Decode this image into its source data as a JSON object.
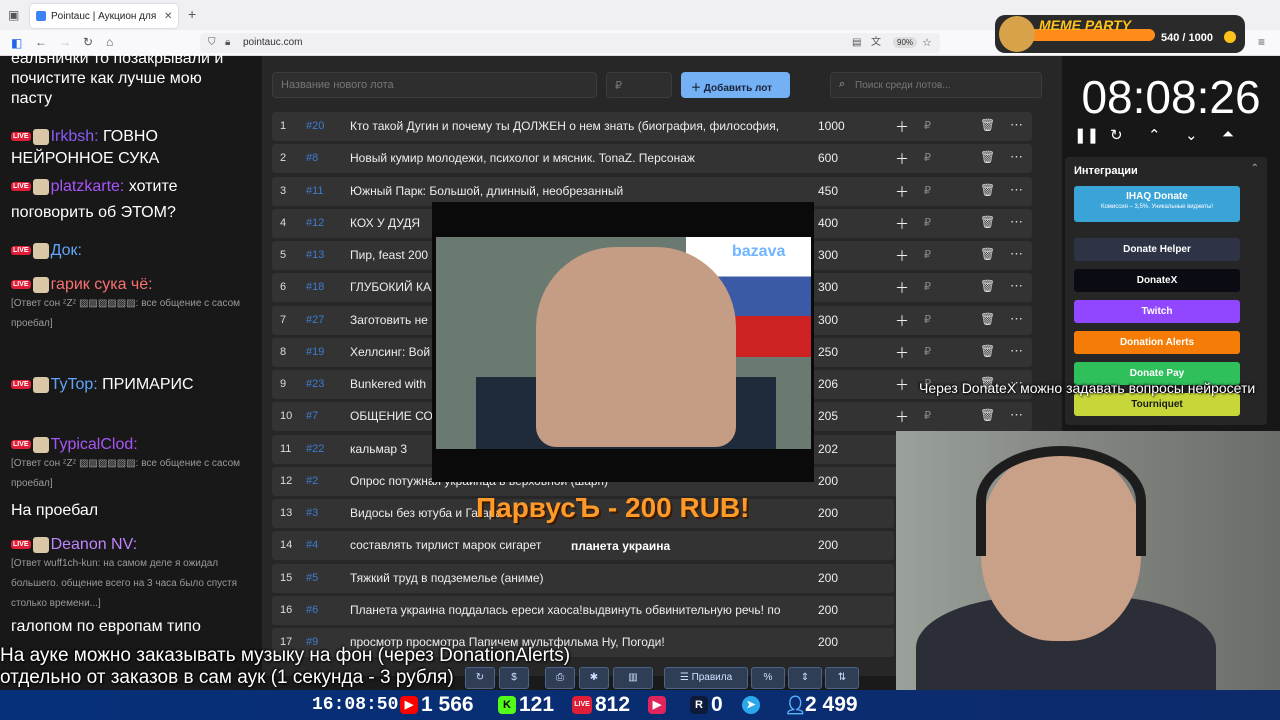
{
  "browser": {
    "tab_title": "Pointauc | Аукцион для стримеров",
    "url": "pointauc.com",
    "zoom": "90%"
  },
  "meme_party": {
    "logo": "MEME PARTY",
    "points": "540 / 1000"
  },
  "chat": {
    "lines": [
      {
        "text": "еальнички то позакрывали и"
      },
      {
        "text": "почистите как лучше мою"
      },
      {
        "text": "пасту"
      },
      {
        "user": "Irkbsh:",
        "text": " ГОВНО",
        "color": "#8b5cf6"
      },
      {
        "text": "НЕЙРОННОЕ СУКА"
      },
      {
        "user": "platzkarte:",
        "text": " хотите",
        "color": "#a855f7"
      },
      {
        "text": "поговорить об ЭТОМ?"
      },
      {
        "user": "Док:",
        "text": "",
        "color": "#60a5fa"
      },
      {
        "user": "гарик сука чё:",
        "text": "",
        "color": "#f87171"
      },
      {
        "text": "[Ответ сон ᶻZᶻ ▨▨▨▨▨▨: все общение с сасом"
      },
      {
        "text": "проебал]"
      },
      {
        "user": "TyTop:",
        "text": " ПРИМАРИС",
        "color": "#60a5fa"
      },
      {
        "user": "TypicalClod:",
        "text": "",
        "color": "#a855f7"
      },
      {
        "text": "[Ответ сон ᶻZᶻ ▨▨▨▨▨▨: все общение с сасом"
      },
      {
        "text": "проебал]"
      },
      {
        "text": "На проебал"
      },
      {
        "user": "Deanon NV:",
        "text": "",
        "color": "#c084fc"
      },
      {
        "text": "[Ответ wuff1ch-kun: на самом деле я ожидал"
      },
      {
        "text": "большего. общение всего на 3 часа было спустя"
      },
      {
        "text": "столько времени...]"
      },
      {
        "text": "галопом по европам типо"
      }
    ],
    "live_badge": "LIVE"
  },
  "toolbar": {
    "lot_name_placeholder": "Название нового лота",
    "price_placeholder": "₽",
    "add_button": "Добавить лот",
    "search_placeholder": "Поиск среди лотов...",
    "rules_button": "Правила",
    "percent_button": "%"
  },
  "lots": [
    {
      "n": "1",
      "id": "#20",
      "title": "Кто такой Дугин и почему ты ДОЛЖЕН о нем знать (биография, философия,",
      "amount": "1000"
    },
    {
      "n": "2",
      "id": "#8",
      "title": "Новый кумир молодежи, психолог и мясник. TonaZ. Персонаж",
      "amount": "600"
    },
    {
      "n": "3",
      "id": "#11",
      "title": "Южный Парк: Большой, длинный, необрезанный",
      "amount": "450"
    },
    {
      "n": "4",
      "id": "#12",
      "title": "КОХ У ДУДЯ",
      "amount": "400"
    },
    {
      "n": "5",
      "id": "#13",
      "title": "Пир, feast 200",
      "amount": "300"
    },
    {
      "n": "6",
      "id": "#18",
      "title": "ГЛУБОКИЙ КА",
      "amount": "300"
    },
    {
      "n": "7",
      "id": "#27",
      "title": "Заготовить не",
      "amount": "300"
    },
    {
      "n": "8",
      "id": "#19",
      "title": "Хеллсинг: Вой",
      "amount": "250"
    },
    {
      "n": "9",
      "id": "#23",
      "title": "Bunkered with",
      "amount": "206"
    },
    {
      "n": "10",
      "id": "#7",
      "title": "ОБЩЕНИЕ СО",
      "amount": "205"
    },
    {
      "n": "11",
      "id": "#22",
      "title": "кальмар 3",
      "amount": "202"
    },
    {
      "n": "12",
      "id": "#2",
      "title": "Опрос потужная украинца в верховной (шарп)",
      "amount": "200"
    },
    {
      "n": "13",
      "id": "#3",
      "title": "Видосы без ютуба и Гагара",
      "amount": "200"
    },
    {
      "n": "14",
      "id": "#4",
      "title": "составлять тирлист марок сигарет",
      "amount": "200"
    },
    {
      "n": "15",
      "id": "#5",
      "title": "Тяжкий труд в подземелье (аниме)",
      "amount": "200"
    },
    {
      "n": "16",
      "id": "#6",
      "title": "Планета украина поддалась ереси хаоса!выдвинуть обвинительную речь! по",
      "amount": "200"
    },
    {
      "n": "17",
      "id": "#9",
      "title": "просмотр просмотра Папичем мультфильма Ну, Погоди!",
      "amount": "200"
    }
  ],
  "video": {
    "logo": "bazava"
  },
  "donation": {
    "line": "ПарвусЪ - 200 RUB!",
    "message": "планета украина"
  },
  "timer": {
    "value": "08:08:26"
  },
  "integrations": {
    "header": "Интеграции",
    "ihaq": "IHAQ Donate",
    "ihaq_sub": "Комиссия – 3,5%. Уникальные виджеты!",
    "items": [
      {
        "label": "Donate Helper",
        "color": "#2e3446"
      },
      {
        "label": "DonateX",
        "color": "#0b0b14"
      },
      {
        "label": "Twitch",
        "color": "#9146ff"
      },
      {
        "label": "Donation Alerts",
        "color": "#f57d07"
      },
      {
        "label": "Donate Pay",
        "color": "#2fbf5b"
      },
      {
        "label": "Tourniquet",
        "color": "#c7d73a"
      }
    ]
  },
  "overlay": {
    "donatex_hint": "Через DonateX можно задавать вопросы нейросети",
    "music_line1": "На ауке можно заказывать музыку на фон (через DonationAlerts)",
    "music_line2": "отдельно от заказов в сам аук (1 секунда - 3 рубля)"
  },
  "stats": {
    "clock": "16:08:50",
    "youtube": "1 566",
    "kick": "121",
    "vk_live": "812",
    "rutube": "0",
    "viewers": "2 499"
  }
}
